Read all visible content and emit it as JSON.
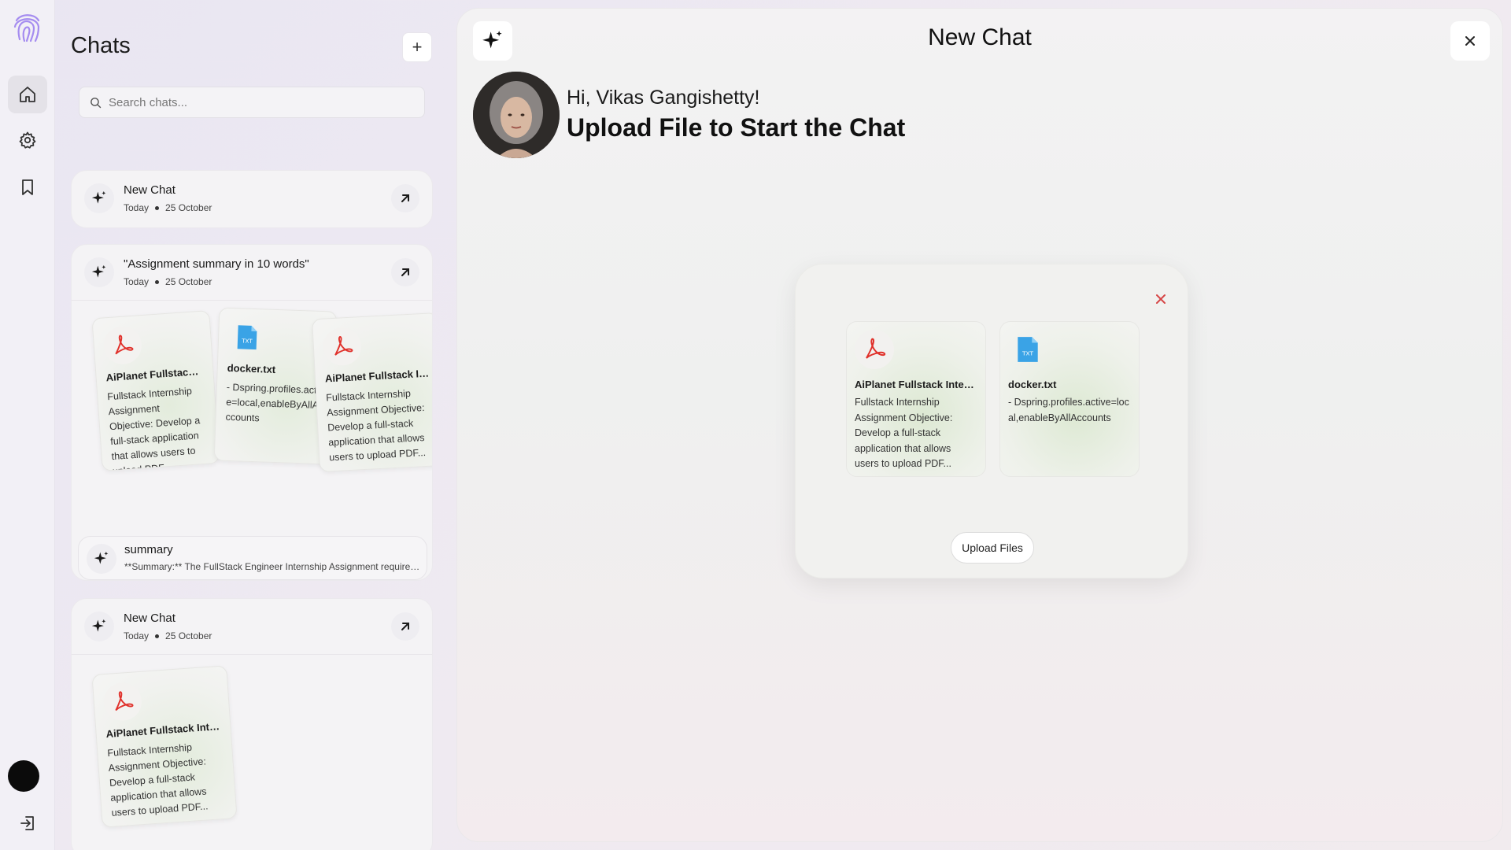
{
  "rail": {
    "items": [
      {
        "icon": "home-icon",
        "active": true
      },
      {
        "icon": "gear-icon",
        "active": false
      },
      {
        "icon": "bookmark-icon",
        "active": false
      }
    ]
  },
  "sidebar": {
    "title": "Chats",
    "new_chat_symbol": "+",
    "search_placeholder": "Search chats...",
    "chats": [
      {
        "title": "New Chat",
        "day": "Today",
        "date": "25 October"
      },
      {
        "title": "\"Assignment summary in 10 words\"",
        "day": "Today",
        "date": "25 October",
        "files": [
          {
            "type": "pdf",
            "name": "AiPlanet Fullstack Intern...",
            "desc": "Fullstack Internship Assignment Objective: Develop a full-stack application that allows users to upload PDF..."
          },
          {
            "type": "txt",
            "name": "docker.txt",
            "desc": "- Dspring.profiles.active=local,enableByAllAccounts"
          },
          {
            "type": "pdf",
            "name": "AiPlanet Fullstack Intern...",
            "desc": "Fullstack Internship Assignment Objective: Develop a full-stack application that allows users to upload PDF..."
          }
        ],
        "summary": {
          "title": "summary",
          "text": "**Summary:** The FullStack Engineer Internship Assignment requires developing a full-stack application"
        }
      },
      {
        "title": "New Chat",
        "day": "Today",
        "date": "25 October",
        "files": [
          {
            "type": "pdf",
            "name": "AiPlanet Fullstack Intern...",
            "desc": "Fullstack Internship Assignment Objective: Develop a full-stack application that allows users to upload PDF..."
          }
        ]
      }
    ]
  },
  "main": {
    "title": "New Chat",
    "greeting": "Hi, Vikas Gangishetty!",
    "headline": "Upload File to Start the Chat",
    "upload": {
      "files": [
        {
          "type": "pdf",
          "name": "AiPlanet Fullstack Intern...",
          "desc": "Fullstack Internship Assignment Objective: Develop a full-stack application that allows users to upload PDF..."
        },
        {
          "type": "txt",
          "name": "docker.txt",
          "desc": "- Dspring.profiles.active=local,enableByAllAccounts"
        }
      ],
      "button_label": "Upload Files"
    }
  },
  "colors": {
    "pdf_red": "#e0312b",
    "txt_blue": "#3aa3e6",
    "close_red": "#d64545"
  }
}
